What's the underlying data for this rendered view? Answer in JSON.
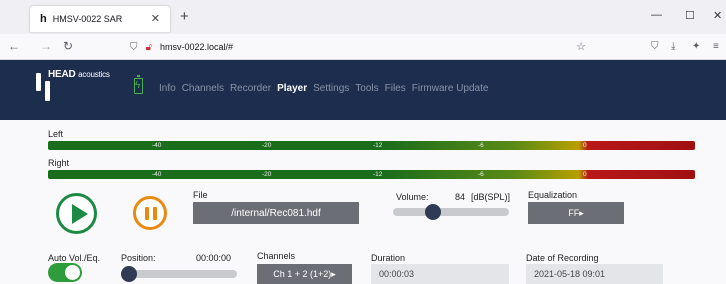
{
  "browser": {
    "tab_title": "HMSV-0022 SAR",
    "tab_icon": "h",
    "url": "hmsv-0022.local/#"
  },
  "app": {
    "logo_text": "HEAD",
    "logo_sub": "acoustics",
    "menu": [
      "Info",
      "Channels",
      "Recorder",
      "Player",
      "Settings",
      "Tools",
      "Files",
      "Firmware Update"
    ],
    "active_menu": "Player"
  },
  "meters": {
    "left_label": "Left",
    "right_label": "Right",
    "ticks": [
      "-40",
      "-20",
      "-12",
      "-6",
      "0"
    ]
  },
  "player": {
    "file_label": "File",
    "file_value": "/internal/Rec081.hdf",
    "volume_label": "Volume:",
    "volume_value": "84",
    "volume_unit": "[dB(SPL)]",
    "equalization_label": "Equalization",
    "equalization_value": "FF▸",
    "auto_label": "Auto Vol./Eq.",
    "position_label": "Position:",
    "position_value": "00:00:00",
    "channels_label": "Channels",
    "channels_value": "Ch 1 + 2 (1+2)▸",
    "duration_label": "Duration",
    "duration_value": "00:00:03",
    "date_label": "Date of Recording",
    "date_value": "2021-05-18 09:01"
  },
  "colors": {
    "header_bg": "#1c2d4e",
    "play": "#1d8a43",
    "pause": "#e88a12",
    "toggle_on": "#2e9c3a"
  }
}
